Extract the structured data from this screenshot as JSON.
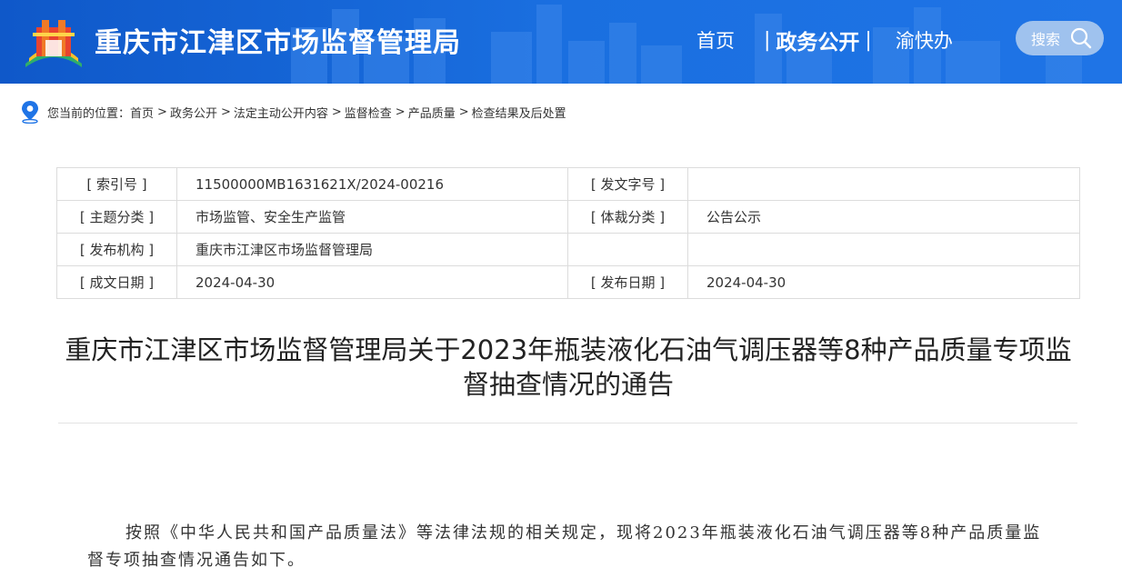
{
  "header": {
    "site_title": "重庆市江津区市场监督管理局",
    "nav": [
      "首页",
      "政务公开",
      "渝快办"
    ],
    "nav_active": "政务公开",
    "search_label": "搜索",
    "colors": {
      "header_blue": "#1a6fe0",
      "search_bg": "#9fc2ee"
    }
  },
  "breadcrumb": {
    "prefix": "您当前的位置：",
    "items": [
      "首页",
      "政务公开",
      "法定主动公开内容",
      "监督检查",
      "产品质量",
      "检查结果及后处置"
    ],
    "separator": ">"
  },
  "meta": {
    "rows": [
      {
        "k1": "[ 索引号 ]",
        "v1": "11500000MB1631621X/2024-00216",
        "k2": "[ 发文字号 ]",
        "v2": ""
      },
      {
        "k1": "[ 主题分类 ]",
        "v1": "市场监管、安全生产监管",
        "k2": "[ 体裁分类 ]",
        "v2": "公告公示"
      },
      {
        "k1": "[ 发布机构 ]",
        "v1": "重庆市江津区市场监督管理局",
        "k2": "",
        "v2": ""
      },
      {
        "k1": "[ 成文日期 ]",
        "v1": "2024-04-30",
        "k2": "[ 发布日期 ]",
        "v2": "2024-04-30"
      }
    ]
  },
  "document": {
    "title_line1": "重庆市江津区市场监督管理局关于2023年瓶装液化石油气调压器等8种产品质量专项监",
    "title_line2": "督抽查情况的通告",
    "paragraph": "按照《中华人民共和国产品质量法》等法律法规的相关规定，现将2023年瓶装液化石油气调压器等8种产品质量监督专项抽查情况通告如下。"
  }
}
